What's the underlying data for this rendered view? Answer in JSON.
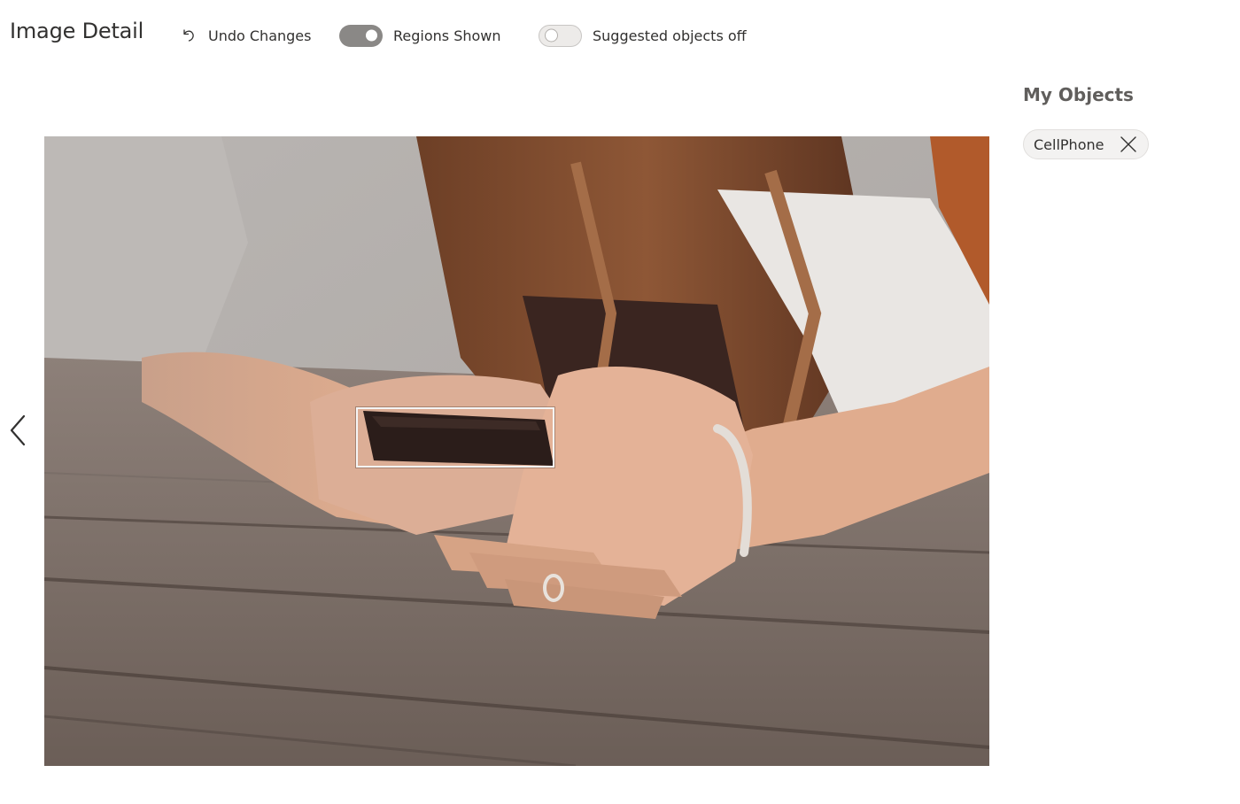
{
  "header": {
    "title": "Image Detail",
    "undo_label": "Undo Changes",
    "regions_toggle": {
      "label": "Regions Shown",
      "on": true
    },
    "suggested_toggle": {
      "label": "Suggested objects off",
      "on": false
    }
  },
  "sidebar": {
    "heading": "My Objects",
    "tags": [
      {
        "label": "CellPhone"
      }
    ]
  },
  "image": {
    "icons": {
      "prev": "chevron-left-icon",
      "undo": "undo-icon",
      "remove_tag": "close-icon"
    },
    "colors": {
      "skin": "#e0ad8f",
      "hair": "#7a4a2f",
      "wood": "#7d7068",
      "shirt": "#eceae8",
      "phone": "#2b1d1a"
    }
  }
}
